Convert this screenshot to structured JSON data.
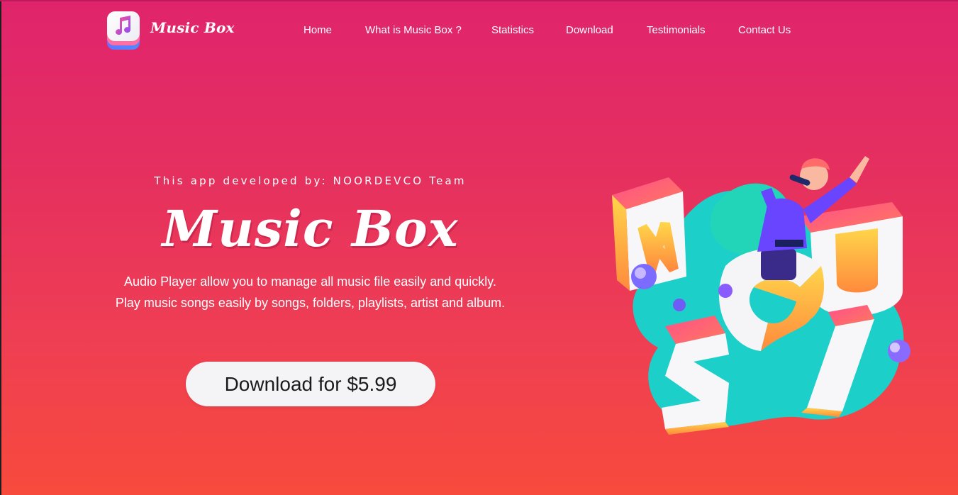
{
  "brand": {
    "name": "Music Box",
    "logo_icon": "music-note-app-icon"
  },
  "nav": {
    "items": [
      {
        "label": "Home"
      },
      {
        "label": "What is Music Box ?"
      },
      {
        "label": "Statistics"
      },
      {
        "label": "Download"
      },
      {
        "label": "Testimonials"
      },
      {
        "label": "Contact Us"
      }
    ]
  },
  "hero": {
    "developer_line": "This app developed by: NOORDEVCO Team",
    "title": "Music Box",
    "description_line1": "Audio Player allow you to manage all music file easily and quickly.",
    "description_line2": "Play music songs easily by songs, folders, playlists, artist and album.",
    "download_button": "Download for $5.99"
  },
  "illustration": {
    "letters": [
      "M",
      "U",
      "S",
      "I",
      "C"
    ],
    "icon": "singer-music-illustration"
  },
  "colors": {
    "bg_top": "#e0246c",
    "bg_bottom": "#f84a3c",
    "button_bg": "#f4f4f6",
    "button_text": "#1b1b1f"
  }
}
